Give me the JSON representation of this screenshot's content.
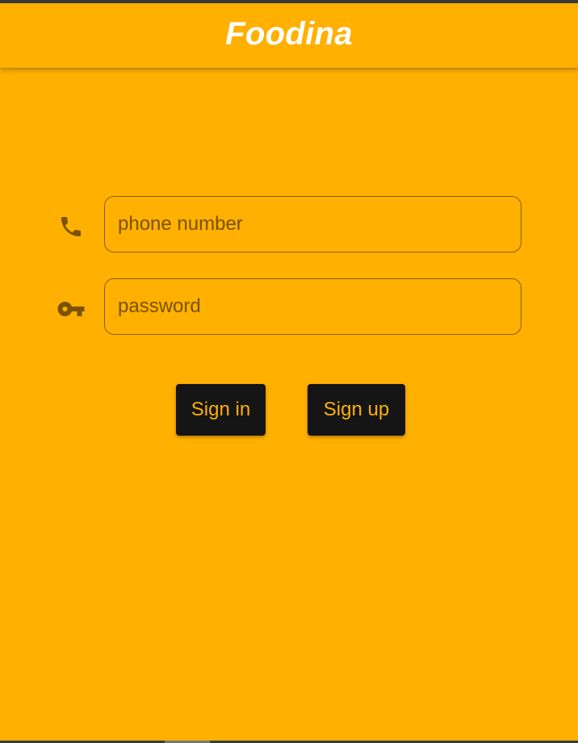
{
  "app": {
    "title": "Foodina"
  },
  "form": {
    "phone_placeholder": "phone number",
    "phone_icon": "phone-icon",
    "password_placeholder": "password",
    "password_icon": "key-icon"
  },
  "actions": {
    "sign_in_label": "Sign in",
    "sign_up_label": "Sign up"
  },
  "colors": {
    "background": "#FFB000",
    "button_bg": "#151515",
    "button_text": "#FFB000",
    "title_text": "#FFFFFF",
    "icon": "#7a5200"
  }
}
